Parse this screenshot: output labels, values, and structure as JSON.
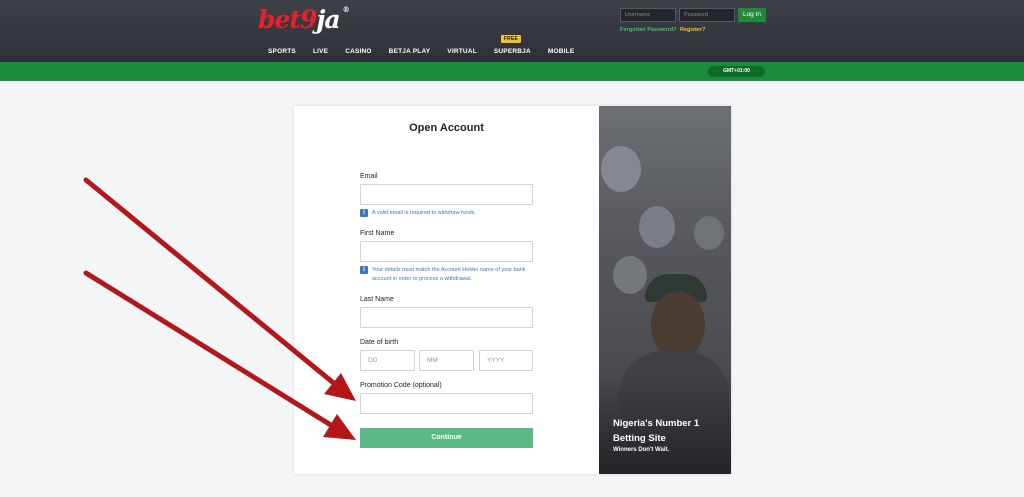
{
  "header": {
    "logo": {
      "part1": "bet",
      "part2": "9",
      "part3": "ja",
      "reg": "®"
    },
    "nav": [
      {
        "label": "SPORTS"
      },
      {
        "label": "LIVE"
      },
      {
        "label": "CASINO"
      },
      {
        "label": "BETJA PLAY"
      },
      {
        "label": "VIRTUAL"
      },
      {
        "label": "SUPERBJA",
        "badge": "FREE"
      },
      {
        "label": "MOBILE"
      }
    ],
    "login": {
      "username_placeholder": "Username",
      "password_placeholder": "Password",
      "login_label": "Log In",
      "forgot_label": "Forgotten Password?",
      "register_label": "Register?"
    },
    "timezone": "GMT+01:00"
  },
  "form": {
    "title": "Open Account",
    "email_label": "Email",
    "email_hint": "A valid email is required to withdraw funds.",
    "first_name_label": "First Name",
    "first_name_hint": "Your details must match the Account Holder name of your bank account in order to process a withdrawal.",
    "last_name_label": "Last Name",
    "dob_label": "Date of birth",
    "dob_day_placeholder": "DD",
    "dob_month_placeholder": "MM",
    "dob_year_placeholder": "YYYY",
    "promo_label": "Promotion Code (optional)",
    "continue_label": "Continue",
    "info_icon": "i"
  },
  "promo": {
    "title": "Nigeria's Number 1 Betting Site",
    "subtitle": "Winners Don't Wait."
  },
  "colors": {
    "brand_red": "#e8202a",
    "brand_green": "#1b8a3a",
    "continue_green": "#5bb985",
    "hint_blue": "#3e79c0",
    "annotation_red": "#b3171a"
  }
}
